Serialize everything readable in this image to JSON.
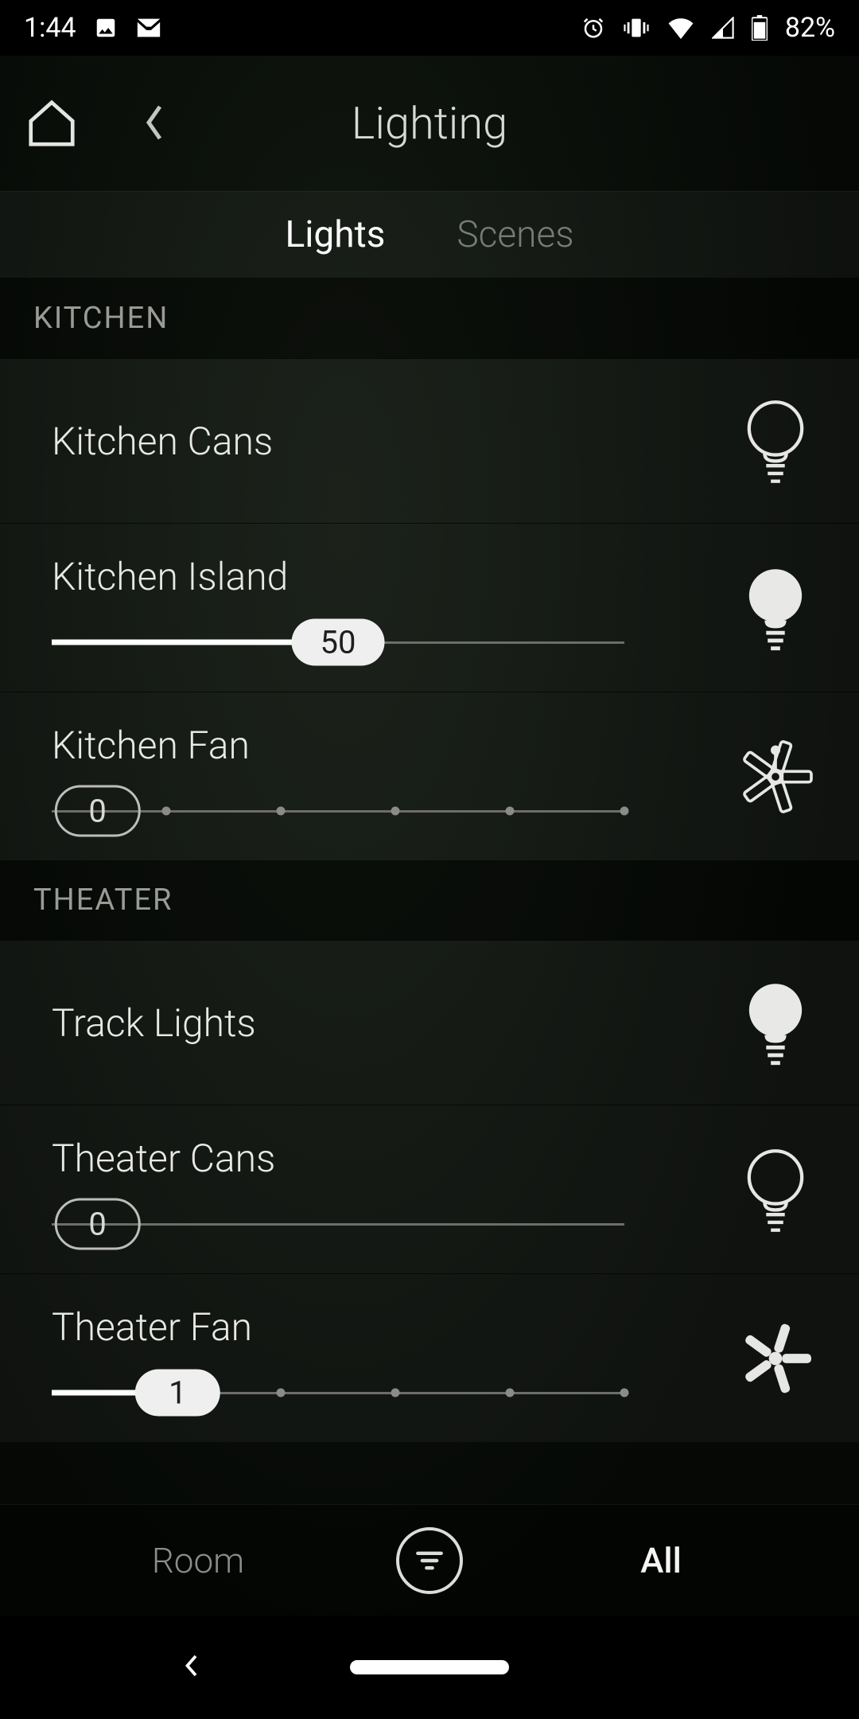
{
  "status": {
    "time": "1:44",
    "battery": "82%"
  },
  "header": {
    "title": "Lighting"
  },
  "tabs": {
    "lights": "Lights",
    "scenes": "Scenes"
  },
  "sections": [
    {
      "title": "KITCHEN",
      "items": [
        {
          "label": "Kitchen Cans",
          "icon": "bulb",
          "state": "off",
          "slider": null
        },
        {
          "label": "Kitchen Island",
          "icon": "bulb",
          "state": "on",
          "slider": {
            "type": "continuous",
            "value": 50,
            "max": 100
          }
        },
        {
          "label": "Kitchen Fan",
          "icon": "fan",
          "state": "off",
          "slider": {
            "type": "stepped",
            "value": 0,
            "steps": 5
          }
        }
      ]
    },
    {
      "title": "THEATER",
      "items": [
        {
          "label": "Track Lights",
          "icon": "bulb",
          "state": "on",
          "slider": null
        },
        {
          "label": "Theater Cans",
          "icon": "bulb",
          "state": "off",
          "slider": {
            "type": "continuous",
            "value": 0,
            "max": 100
          }
        },
        {
          "label": "Theater Fan",
          "icon": "fan",
          "state": "on",
          "slider": {
            "type": "stepped",
            "value": 1,
            "steps": 5
          }
        }
      ]
    }
  ],
  "bottom": {
    "room": "Room",
    "all": "All"
  }
}
